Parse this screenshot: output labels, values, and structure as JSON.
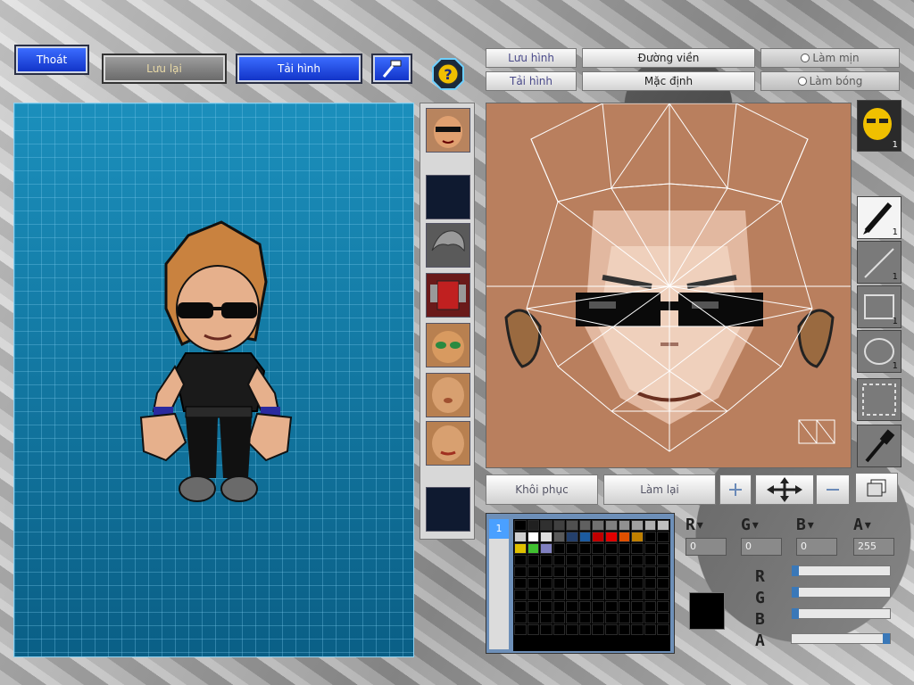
{
  "top_buttons": {
    "exit": "Thoát",
    "save": "Lưu lại",
    "load_image": "Tải hình"
  },
  "editor_tabs": {
    "save_image": "Lưu hình",
    "load_image": "Tải hình",
    "outline": "Đường viền",
    "default": "Mặc định",
    "smooth": "Làm mịn",
    "shade": "Làm bóng"
  },
  "tool_counts": {
    "pen": "1",
    "line": "1",
    "rect": "1",
    "ellipse": "1",
    "avatar": "1"
  },
  "bottom_buttons": {
    "restore": "Khôi phục",
    "redo": "Làm lại"
  },
  "color": {
    "r": "0",
    "g": "0",
    "b": "0",
    "a": "255",
    "current": "#000000"
  },
  "palette_colors": [
    "#000000",
    "#202020",
    "#303030",
    "#404040",
    "#505050",
    "#606060",
    "#707070",
    "#808080",
    "#909090",
    "#a0a0a0",
    "#b0b0b0",
    "#c0c0c0",
    "#d0d0d0",
    "#ffffff",
    "#e0e0e0",
    "#5a5a5a",
    "#24406c",
    "#1c5ba0",
    "#c00000",
    "#e00000",
    "#e05000",
    "#c08000",
    "#000000",
    "#000000",
    "#e0c000",
    "#40c030",
    "#8080c0"
  ],
  "slider_levels": {
    "r": 0,
    "g": 0,
    "b": 0,
    "a": 1.0
  },
  "palette_tab_label": "1",
  "help_icon": "question-mark-icon",
  "hammer_icon": "hammer-icon"
}
